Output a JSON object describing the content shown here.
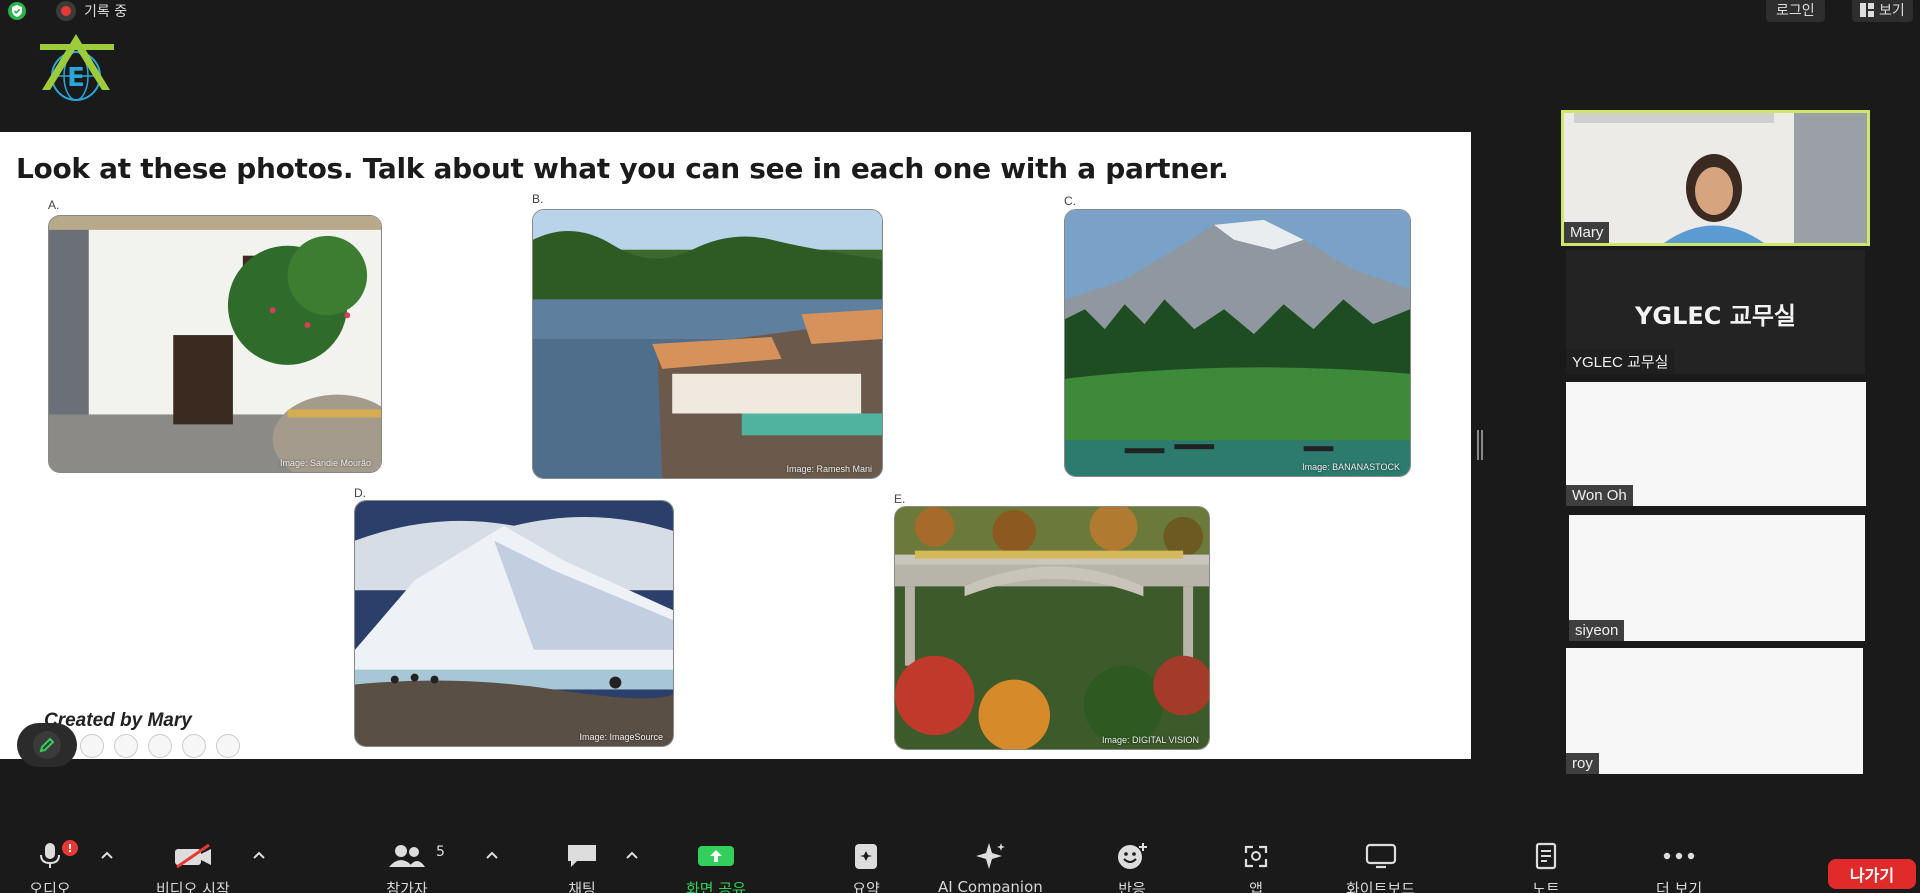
{
  "topbar": {
    "recording_label": "기록 중",
    "login_label": "로그인",
    "view_label": "보기"
  },
  "slide": {
    "title": "Look at these photos. Talk about what you can see in each one with a partner.",
    "created_by": "Created by Mary",
    "photos": [
      {
        "label": "A.",
        "credit": "Image: Sandie Mourão"
      },
      {
        "label": "B.",
        "credit": "Image: Ramesh Mani"
      },
      {
        "label": "C.",
        "credit": "Image: BANANASTOCK"
      },
      {
        "label": "D.",
        "credit": "Image: ImageSource"
      },
      {
        "label": "E.",
        "credit": "Image: DIGITAL VISION"
      }
    ]
  },
  "participants": [
    {
      "name": "Mary"
    },
    {
      "name": "YGLEC 교무실",
      "display": "YGLEC 교무실"
    },
    {
      "name": "Won Oh"
    },
    {
      "name": "siyeon"
    },
    {
      "name": "roy"
    }
  ],
  "toolbar": {
    "audio_label": "오디오",
    "audio_badge": "!",
    "video_label": "비디오 시작",
    "participants_label": "참가자",
    "participants_count": "5",
    "chat_label": "채팅",
    "share_label": "화면 공유",
    "summary_label": "요약",
    "ai_label": "AI Companion",
    "reactions_label": "반응",
    "apps_label": "앱",
    "whiteboard_label": "화이트보드",
    "notes_label": "노트",
    "more_label": "더 보기",
    "leave_label": "나가기"
  },
  "colors": {
    "active_speaker_border": "#cde66b",
    "share_green": "#32d05a",
    "leave_red": "#e12b2b",
    "background": "#1a1a1a"
  }
}
